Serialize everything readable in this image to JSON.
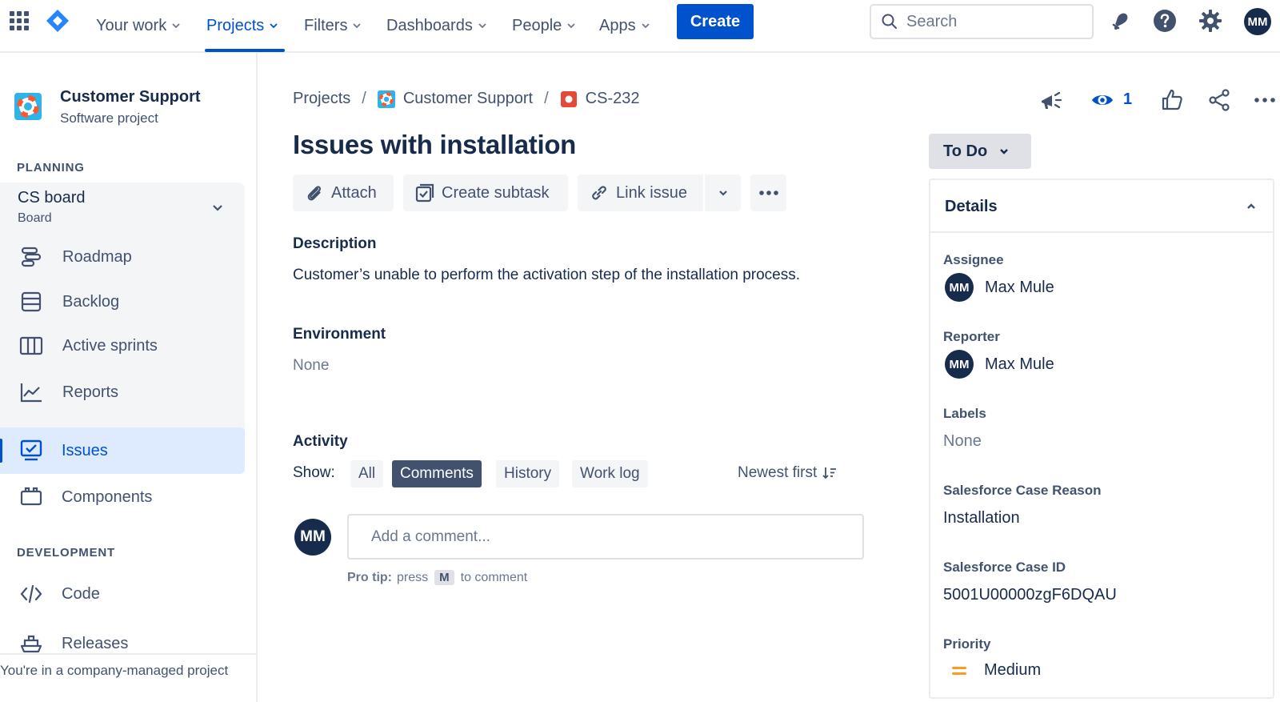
{
  "nav": {
    "items": [
      {
        "label": "Your work",
        "active": false
      },
      {
        "label": "Projects",
        "active": true
      },
      {
        "label": "Filters",
        "active": false
      },
      {
        "label": "Dashboards",
        "active": false
      },
      {
        "label": "People",
        "active": false
      },
      {
        "label": "Apps",
        "active": false
      }
    ],
    "create_label": "Create",
    "search_placeholder": "Search",
    "user_initials": "MM",
    "accent_color": "#0052cc"
  },
  "sidebar": {
    "project_name": "Customer Support",
    "project_type": "Software project",
    "planning_title": "PLANNING",
    "board_name": "CS board",
    "board_sub": "Board",
    "planning_items": [
      {
        "label": "Roadmap",
        "icon": "roadmap-icon"
      },
      {
        "label": "Backlog",
        "icon": "backlog-icon"
      },
      {
        "label": "Active sprints",
        "icon": "active-sprints-icon"
      },
      {
        "label": "Reports",
        "icon": "reports-icon"
      }
    ],
    "issues_label": "Issues",
    "components_label": "Components",
    "development_title": "DEVELOPMENT",
    "code_label": "Code",
    "releases_label": "Releases",
    "footer": "You're in a company-managed project"
  },
  "breadcrumb": {
    "projects": "Projects",
    "project": "Customer Support",
    "issue_key": "CS-232",
    "separator": "/"
  },
  "issue": {
    "title": "Issues with installation",
    "actions": {
      "attach": "Attach",
      "create_subtask": "Create subtask",
      "link_issue": "Link issue"
    },
    "description_label": "Description",
    "description": "Customer’s unable to perform the activation step of the installation process.",
    "environment_label": "Environment",
    "environment": "None"
  },
  "activity": {
    "title": "Activity",
    "show_label": "Show:",
    "filters": [
      {
        "label": "All",
        "selected": false
      },
      {
        "label": "Comments",
        "selected": true
      },
      {
        "label": "History",
        "selected": false
      },
      {
        "label": "Work log",
        "selected": false
      }
    ],
    "sort_label": "Newest first",
    "user_initials": "MM",
    "comment_placeholder": "Add a comment...",
    "pro_tip_label": "Pro tip:",
    "pro_tip_press": "press",
    "pro_tip_key": "M",
    "pro_tip_suffix": "to comment"
  },
  "right": {
    "watch_count": "1",
    "status": "To Do",
    "details_title": "Details",
    "assignee_label": "Assignee",
    "assignee_initials": "MM",
    "assignee": "Max Mule",
    "reporter_label": "Reporter",
    "reporter_initials": "MM",
    "reporter": "Max Mule",
    "labels_label": "Labels",
    "labels": "None",
    "case_reason_label": "Salesforce Case Reason",
    "case_reason": "Installation",
    "case_id_label": "Salesforce Case ID",
    "case_id": "5001U00000zgF6DQAU",
    "priority_label": "Priority",
    "priority": "Medium",
    "priority_color": "#ff991f"
  }
}
